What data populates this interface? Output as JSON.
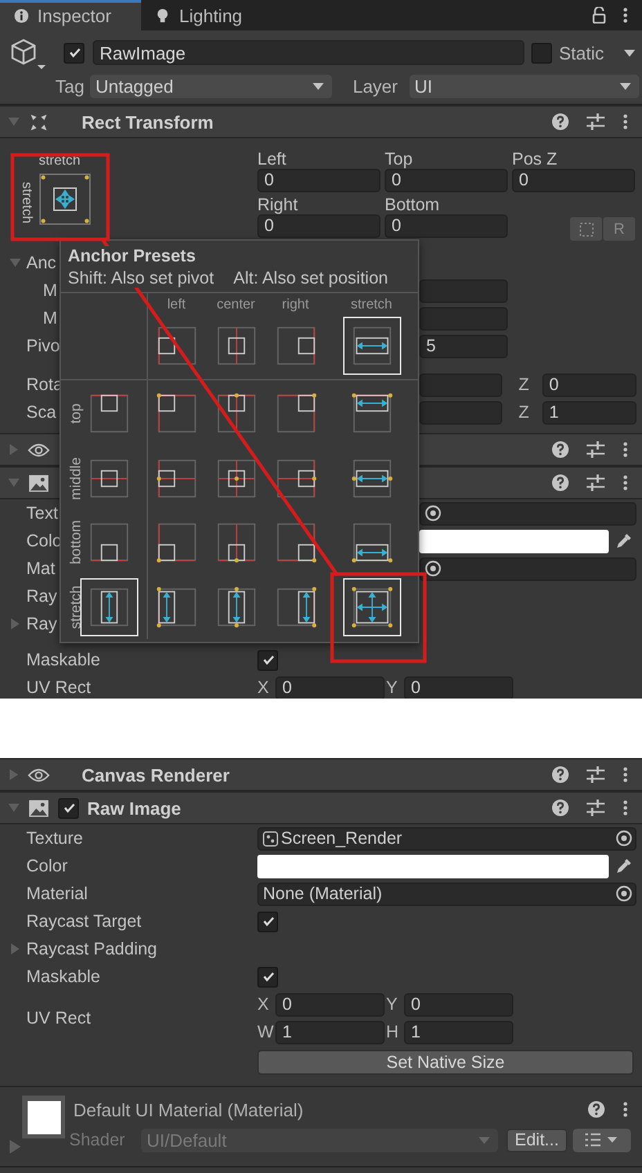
{
  "view_1": {
    "tabs": [
      {
        "label": "Inspector",
        "selected": true
      },
      {
        "label": "Lighting",
        "selected": false
      }
    ],
    "object": {
      "active": true,
      "name": "RawImage",
      "static": false,
      "static_label": "Static",
      "tag_label": "Tag",
      "tag": "Untagged",
      "layer_label": "Layer",
      "layer": "UI"
    },
    "items": [
      {
        "kind": "transform_header",
        "expanded": true,
        "title": "Rect Transform"
      },
      {
        "kind": "rect_body",
        "anchor": {
          "horizontal": "stretch",
          "vertical": "stretch"
        },
        "fields": [
          [
            {
              "label": "Left",
              "value": "0"
            },
            {
              "label": "Top",
              "value": "0"
            },
            {
              "label": "Pos Z",
              "value": "0"
            }
          ],
          [
            {
              "label": "Right",
              "value": "0"
            },
            {
              "label": "Bottom",
              "value": "0"
            }
          ]
        ],
        "button": "R"
      },
      {
        "kind": "foldout",
        "label": "Anc",
        "expanded": true
      },
      {
        "kind": "field",
        "label": "M"
      },
      {
        "kind": "field",
        "label": "M"
      },
      {
        "kind": "field",
        "label": "Pivo",
        "value": "5"
      },
      {
        "kind": "field",
        "label": "Rota",
        "z_label": "Z",
        "z_value": "0"
      },
      {
        "kind": "field",
        "label": "Sca",
        "z_label": "Z",
        "z_value": "1"
      },
      {
        "kind": "renderer_header",
        "expanded": false
      },
      {
        "kind": "image_header",
        "expanded": true
      },
      {
        "kind": "object_field",
        "label": "Text"
      },
      {
        "kind": "color",
        "label": "Colo",
        "color": "#ffffff"
      },
      {
        "kind": "object_field",
        "label": "Mat"
      },
      {
        "kind": "label",
        "label": "Ray"
      },
      {
        "kind": "foldout",
        "label": "Ray",
        "expanded": false
      },
      {
        "kind": "toggle",
        "label": "Maskable",
        "checked": true
      },
      {
        "kind": "vector",
        "label": "UV Rect",
        "components": [
          {
            "axis": "X",
            "value": "0"
          },
          {
            "axis": "Y",
            "value": "0"
          }
        ]
      }
    ],
    "anchor_presets": {
      "title": "Anchor Presets",
      "hint_shift": "Shift: Also set pivot",
      "hint_alt": "Alt: Also set position",
      "columns": [
        {
          "label": "left",
          "kind": "left",
          "selected": false
        },
        {
          "label": "center",
          "kind": "center",
          "selected": false
        },
        {
          "label": "right",
          "kind": "right",
          "selected": false
        },
        {
          "label": "stretch",
          "kind": "stretch",
          "selected": true
        }
      ],
      "rows": [
        {
          "label": "top",
          "kind": "top",
          "selected": false
        },
        {
          "label": "middle",
          "kind": "middle",
          "selected": false
        },
        {
          "label": "bottom",
          "kind": "bottom",
          "selected": false
        },
        {
          "label": "stretch",
          "kind": "stretch",
          "selected": true
        }
      ]
    }
  },
  "view_2": {
    "items": [
      {
        "kind": "renderer_header",
        "expanded": false,
        "title": "Canvas Renderer"
      },
      {
        "kind": "image_header",
        "expanded": true,
        "enabled": true,
        "title": "Raw Image"
      },
      {
        "kind": "asset_field",
        "label": "Texture",
        "value": "Screen_Render"
      },
      {
        "kind": "color",
        "label": "Color",
        "color": "#ffffff"
      },
      {
        "kind": "object_field",
        "label": "Material",
        "value": "None (Material)"
      },
      {
        "kind": "toggle",
        "label": "Raycast Target",
        "checked": true
      },
      {
        "kind": "foldout",
        "label": "Raycast Padding",
        "expanded": false
      },
      {
        "kind": "toggle",
        "label": "Maskable",
        "checked": true
      },
      {
        "kind": "vector",
        "label": "UV Rect",
        "components": [
          {
            "axis": "X",
            "value": "0"
          },
          {
            "axis": "Y",
            "value": "0"
          },
          {
            "axis": "W",
            "value": "1"
          },
          {
            "axis": "H",
            "value": "1"
          }
        ]
      },
      {
        "kind": "button",
        "label": "Set Native Size"
      },
      {
        "kind": "material",
        "name": "Default UI Material (Material)",
        "expanded": false,
        "shader_label": "Shader",
        "shader": "UI/Default",
        "edit": "Edit..."
      }
    ]
  }
}
